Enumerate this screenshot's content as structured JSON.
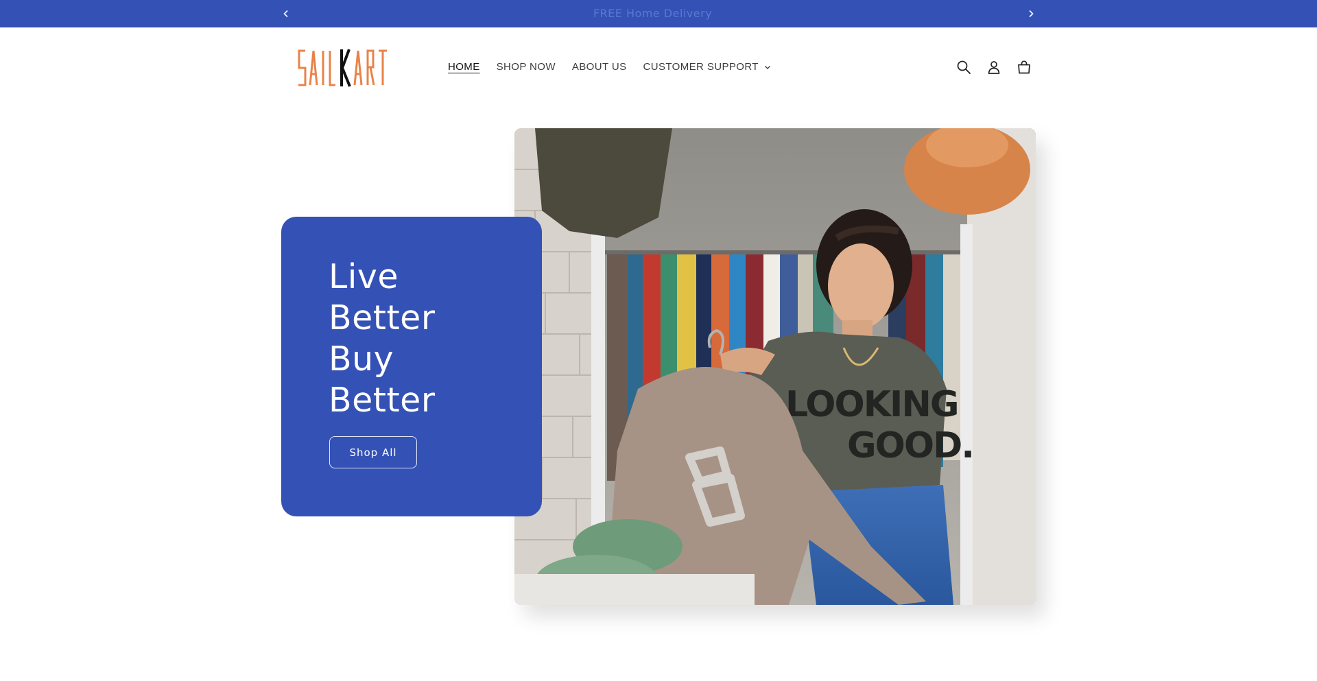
{
  "announcement": {
    "message": "FREE Home Delivery",
    "prev_icon": "chevron-left-icon",
    "next_icon": "chevron-right-icon"
  },
  "header": {
    "logo": {
      "text": "SAILKART",
      "colors": {
        "primary": "#e8834a",
        "accent": "#111111"
      }
    },
    "nav": [
      {
        "label": "HOME",
        "active": true
      },
      {
        "label": "SHOP NOW"
      },
      {
        "label": "ABOUT US"
      },
      {
        "label": "CUSTOMER SUPPORT",
        "has_dropdown": true
      }
    ],
    "icons": [
      "search-icon",
      "account-icon",
      "cart-icon"
    ]
  },
  "hero": {
    "title_lines": [
      "Live",
      "Better",
      "Buy",
      "Better"
    ],
    "button_label": "Shop All",
    "image_icon": "hero-photo",
    "image_text": {
      "line1": "LOOKING",
      "line2": "GOOD."
    }
  },
  "colors": {
    "brand_blue": "#3451b6",
    "background": "#ffffff",
    "text": "#3b3b3b"
  }
}
